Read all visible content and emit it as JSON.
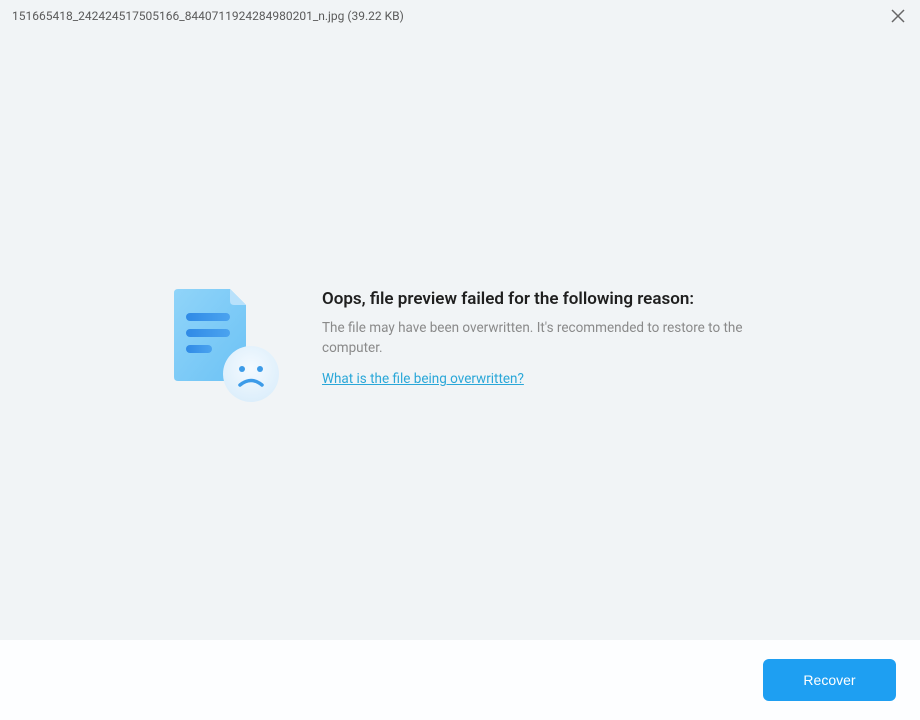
{
  "header": {
    "filename": "151665418_242424517505166_8440711924284980201_n.jpg (39.22 KB)"
  },
  "error": {
    "title": "Oops, file preview failed for the following reason:",
    "description": "The file may have been overwritten. It's recommended to restore to the computer.",
    "help_link": "What is the file being overwritten?"
  },
  "footer": {
    "recover_label": "Recover"
  }
}
